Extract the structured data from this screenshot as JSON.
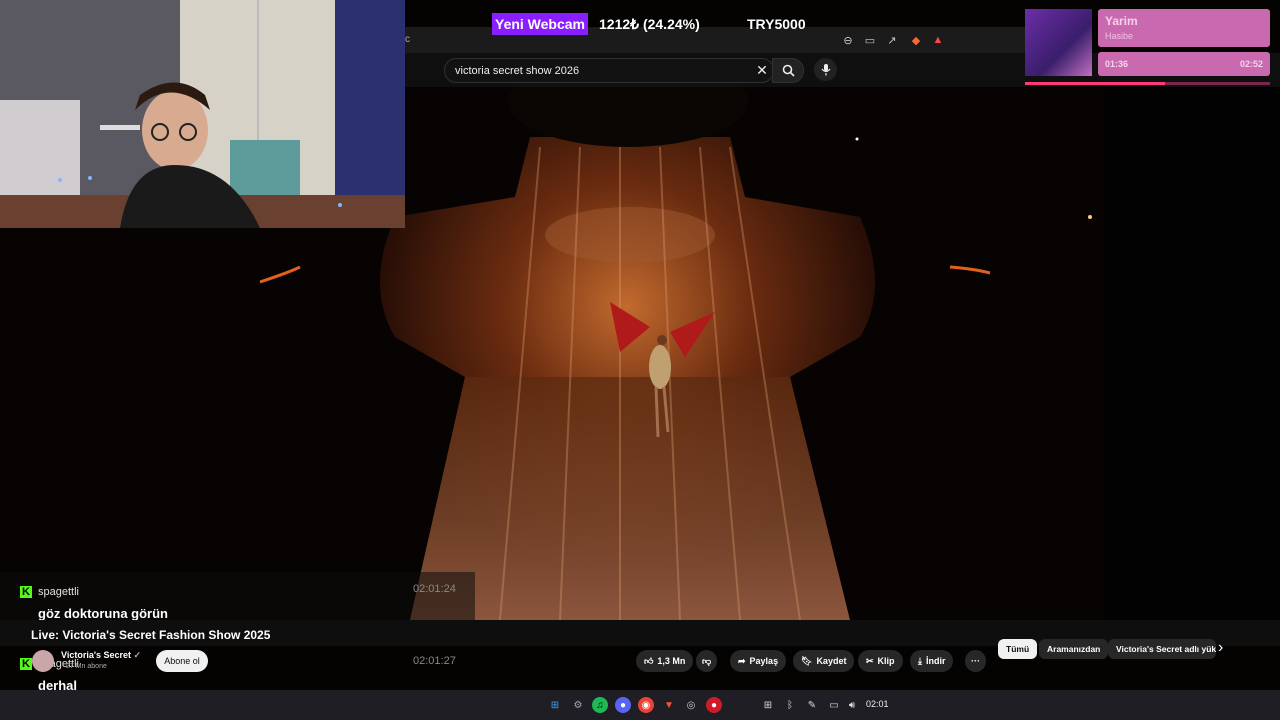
{
  "overlay": {
    "webcam_label": "Yeni Webcam",
    "stat": "1212₺ (24.24%)",
    "goal": "TRY5000"
  },
  "browser": {
    "url_fragment": "c"
  },
  "youtube": {
    "search_value": "victoria secret show 2026",
    "video_title": "Live: Victoria's Secret Fashion Show 2025",
    "channel": {
      "name": "Victoria's Secret",
      "verified": "✓",
      "subs": "27 Mn abone"
    },
    "subscribe_label": "Abone ol",
    "actions": {
      "likes": "1,3 Mn",
      "share": "Paylaş",
      "save": "Kaydet",
      "clip": "Klip",
      "download": "İndir",
      "more": "···"
    },
    "chips": [
      "Tümü",
      "Aramanızdan",
      "Victoria's Secret adlı yük"
    ],
    "chip_next": "›"
  },
  "chat": {
    "messages": [
      {
        "user": "spagettli",
        "text": "göz doktoruna görün",
        "time": "02:01:24"
      },
      {
        "user": "spagettli",
        "text": "derhal",
        "time": "02:01:27"
      }
    ],
    "platform_icon": "K"
  },
  "music": {
    "song": "Yarim",
    "artist": "Hasibe",
    "current": "01:36",
    "total": "02:52",
    "progress": 0.57
  },
  "taskbar": {
    "clock": "02:01"
  },
  "colors": {
    "accent_purple": "#8a1eff",
    "kick_green": "#53fc18",
    "music_pink": "#c96ab0"
  }
}
